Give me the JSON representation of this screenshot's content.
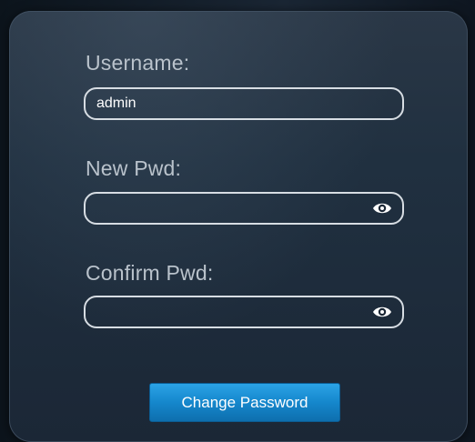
{
  "form": {
    "username": {
      "label": "Username:",
      "value": "admin"
    },
    "new_pwd": {
      "label": "New Pwd:",
      "value": "",
      "toggle_icon": "eye-icon"
    },
    "confirm_pwd": {
      "label": "Confirm Pwd:",
      "value": "",
      "toggle_icon": "eye-icon"
    },
    "submit_label": "Change Password"
  },
  "colors": {
    "panel": "#1e2b3a",
    "field_border": "#d7dde3",
    "label_text": "#b9c2cb",
    "button": "#1587cc"
  }
}
